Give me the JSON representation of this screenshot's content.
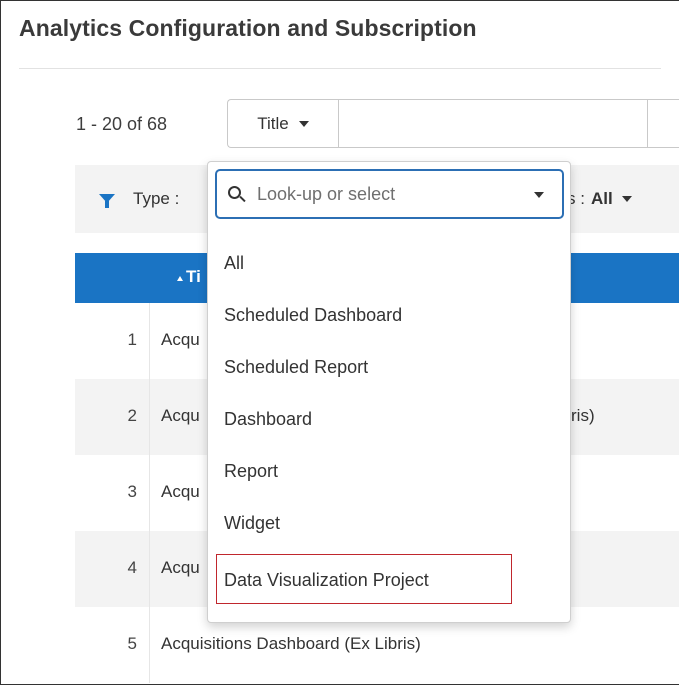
{
  "page": {
    "title": "Analytics Configuration and Subscription"
  },
  "toolbar": {
    "count_text": "1 - 20 of 68",
    "search_type": "Title",
    "search_value": ""
  },
  "filters": {
    "type_label": "Type :",
    "status_label": "s :",
    "status_value": "All"
  },
  "table": {
    "title_header": "Ti",
    "rows": [
      {
        "num": "1",
        "title": "Acqu",
        "tail": ""
      },
      {
        "num": "2",
        "title": "Acqu",
        "tail": "ris)"
      },
      {
        "num": "3",
        "title": "Acqu",
        "tail": ""
      },
      {
        "num": "4",
        "title": "Acqu",
        "tail": ""
      },
      {
        "num": "5",
        "title": "Acquisitions Dashboard (Ex Libris)",
        "tail": ""
      }
    ]
  },
  "dropdown": {
    "placeholder": "Look-up or select",
    "options": [
      "All",
      "Scheduled Dashboard",
      "Scheduled Report",
      "Dashboard",
      "Report",
      "Widget",
      "Data Visualization Project"
    ],
    "highlighted_option": "Data Visualization Project",
    "highlight_color": "#c0272d"
  },
  "colors": {
    "accent": "#1a74c4",
    "focus_border": "#2c6fb4"
  }
}
